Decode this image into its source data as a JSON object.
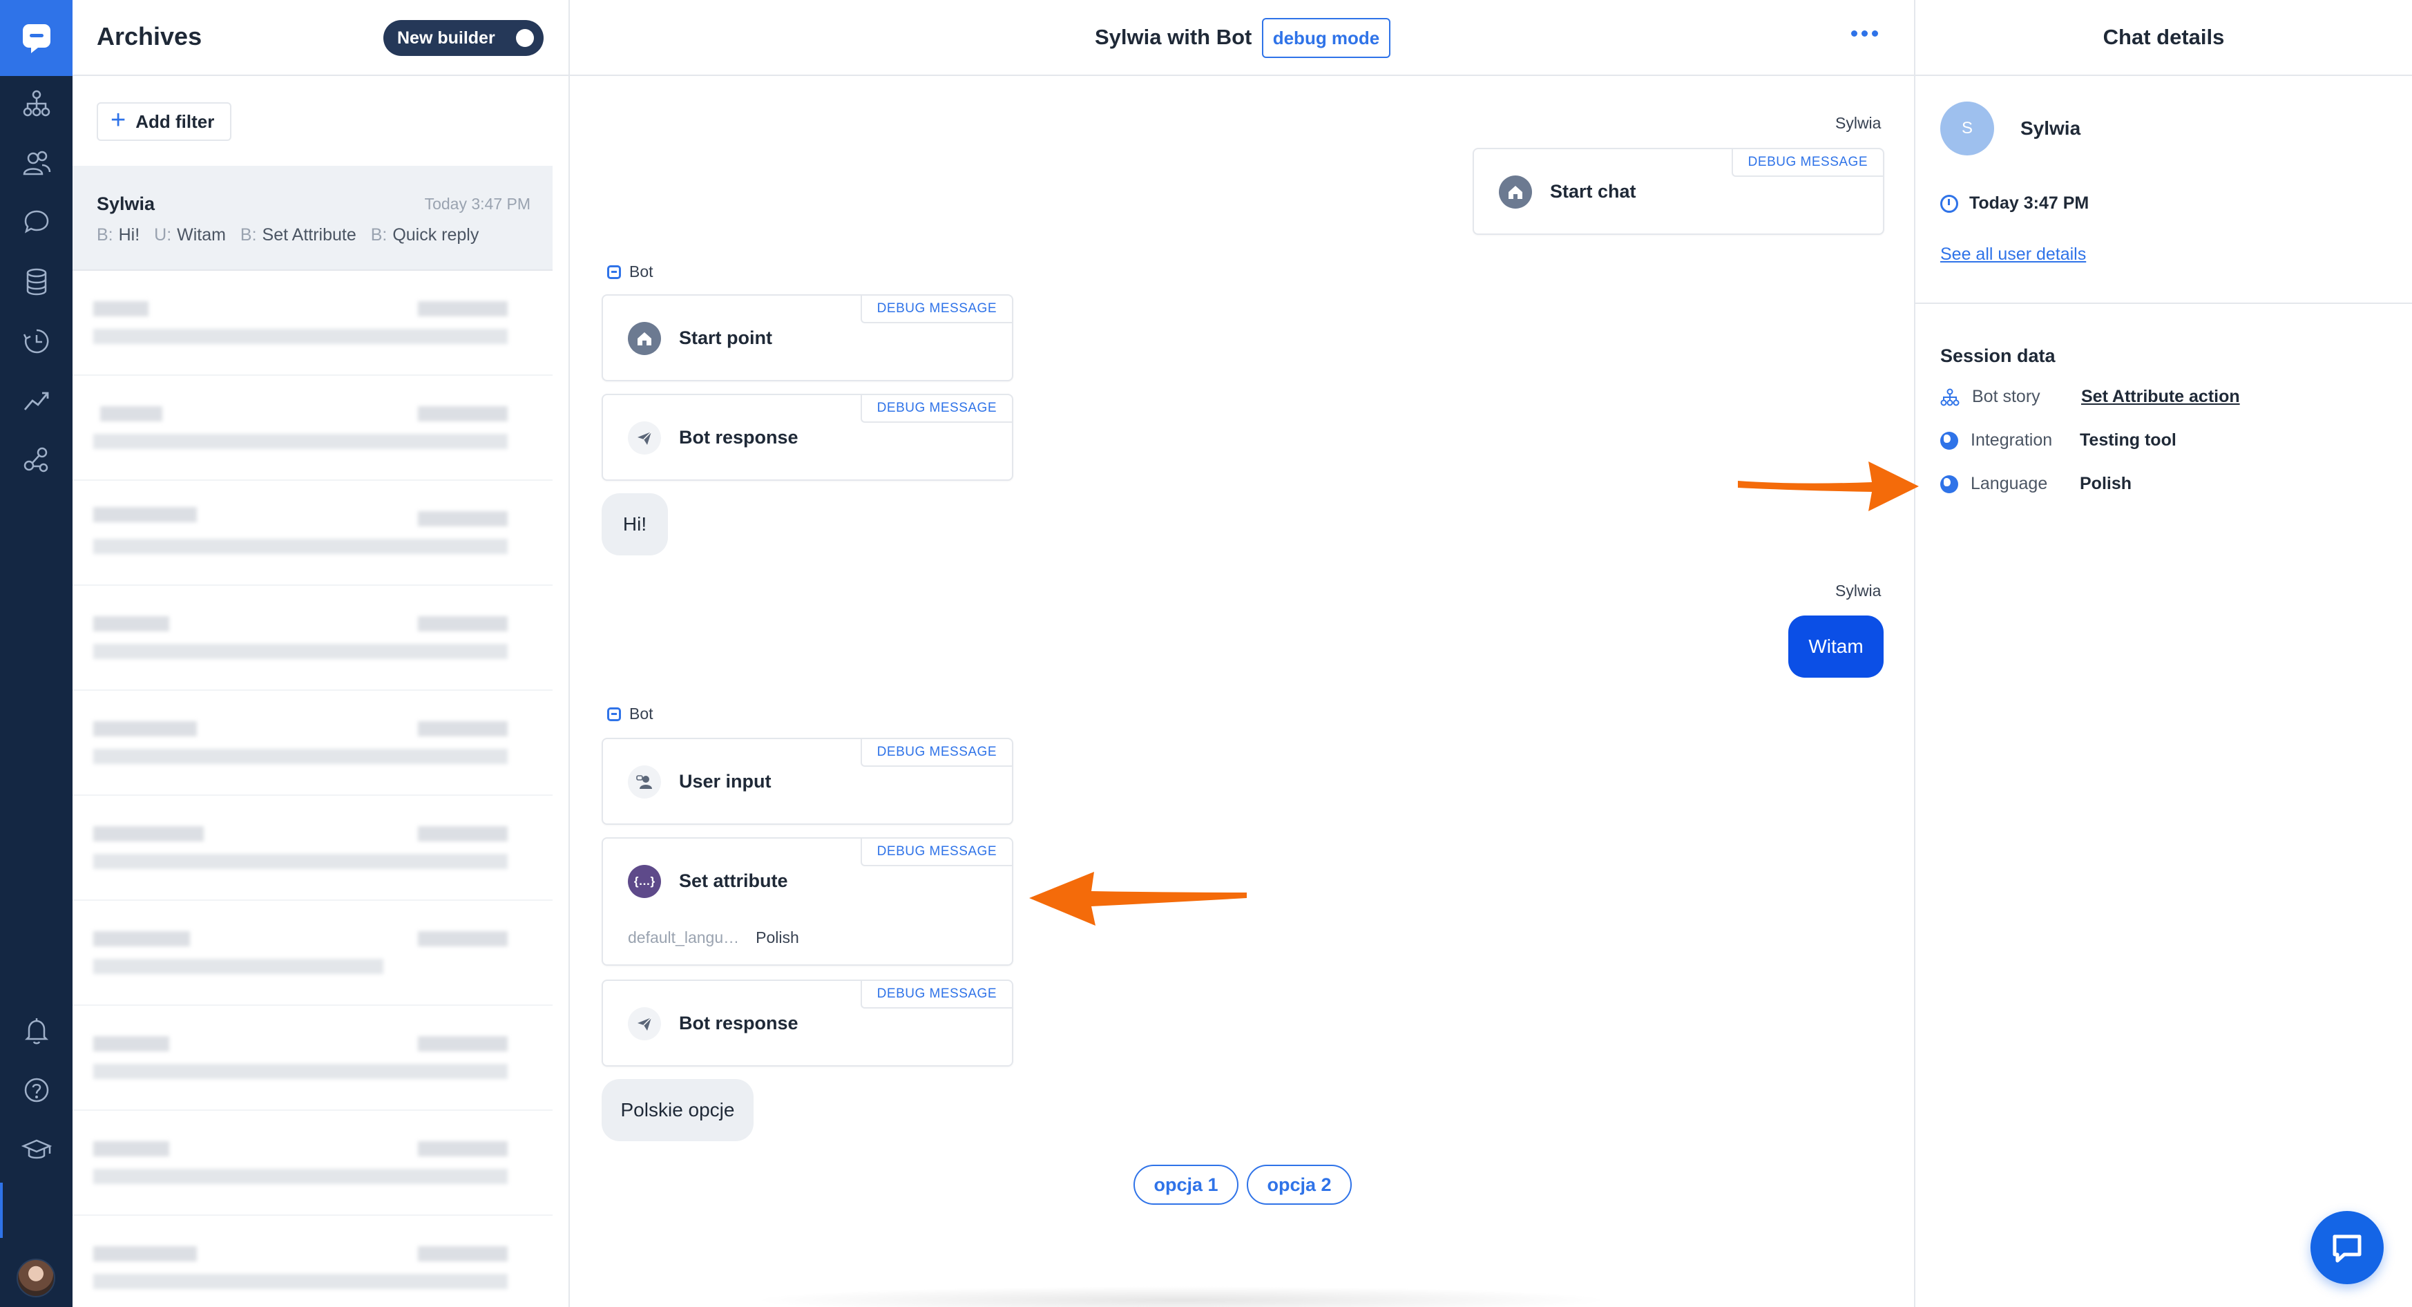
{
  "nav": {
    "items": [
      "bot-builder-icon",
      "users-icon",
      "chats-icon",
      "database-icon",
      "history-icon",
      "reports-icon",
      "integrations-icon"
    ],
    "bottom_items": [
      "bell-icon",
      "help-icon",
      "academy-icon"
    ]
  },
  "archives": {
    "title": "Archives",
    "builder_toggle_label": "New builder",
    "add_filter_label": "Add filter",
    "selected_chat": {
      "name": "Sylwia",
      "time": "Today 3:47 PM",
      "preview": [
        {
          "who": "B:",
          "text": "Hi!"
        },
        {
          "who": "U:",
          "text": "Witam"
        },
        {
          "who": "B:",
          "text": "Set Attribute"
        },
        {
          "who": "B:",
          "text": "Quick reply"
        }
      ]
    }
  },
  "conversation": {
    "title": "Sylwia with Bot",
    "debug_badge": "debug mode",
    "user_name": "Sylwia",
    "bot_name": "Bot",
    "debug_tag": "DEBUG MESSAGE",
    "start_chat": "Start chat",
    "block1": {
      "start_point": "Start point",
      "bot_response": "Bot response",
      "bubble": "Hi!"
    },
    "user_message": "Witam",
    "block2": {
      "user_input": "User input",
      "set_attribute": "Set attribute",
      "attr_key": "default_langu…",
      "attr_value": "Polish",
      "bot_response": "Bot response",
      "bubble": "Polskie opcje"
    },
    "quick_replies": [
      "opcja 1",
      "opcja 2"
    ]
  },
  "details": {
    "title": "Chat details",
    "avatar_initial": "S",
    "user_name": "Sylwia",
    "time": "Today 3:47 PM",
    "user_link": "See all user details",
    "session_title": "Session data",
    "rows": [
      {
        "key": "Bot story",
        "value": "Set Attribute action"
      },
      {
        "key": "Integration",
        "value": "Testing tool"
      },
      {
        "key": "Language",
        "value": "Polish"
      }
    ]
  },
  "colors": {
    "accent": "#2f73e8",
    "rail": "#142743",
    "user_bubble": "#0b4fe6",
    "annotation_arrow": "#f46b0a"
  }
}
